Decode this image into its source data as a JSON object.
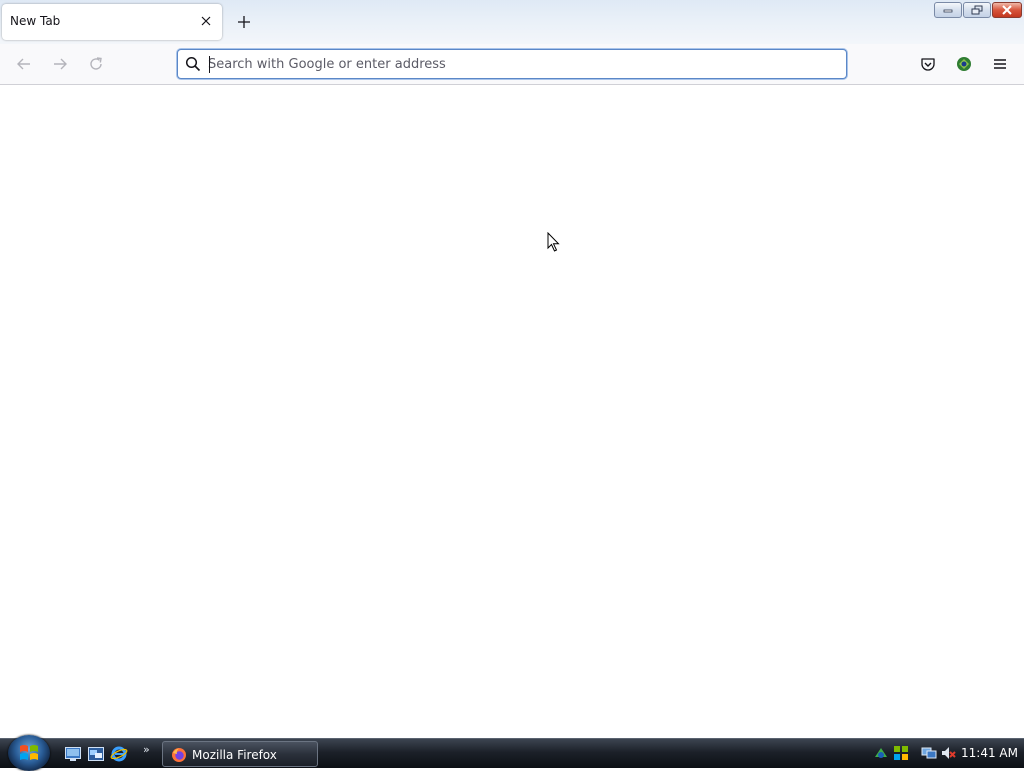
{
  "browser": {
    "tab": {
      "title": "New Tab"
    },
    "urlbar": {
      "placeholder": "Search with Google or enter address",
      "value": ""
    }
  },
  "taskbar": {
    "active_task_label": "Mozilla Firefox",
    "clock": "11:41 AM"
  },
  "icons": {
    "window_controls": [
      "minimize-icon",
      "restore-icon",
      "close-icon"
    ],
    "navigation": [
      "back-arrow-icon",
      "forward-arrow-icon",
      "reload-icon"
    ],
    "toolbar_right": [
      "pocket-icon",
      "extension-icon",
      "hamburger-menu-icon"
    ],
    "quick_launch": [
      "show-desktop-icon",
      "switch-windows-icon",
      "internet-explorer-icon"
    ],
    "tray": [
      "tray-app-icon",
      "network-icon",
      "volume-muted-icon"
    ]
  },
  "colors": {
    "urlbar_focus": "#5b87c7",
    "tray_close_red": "#c2381f"
  }
}
